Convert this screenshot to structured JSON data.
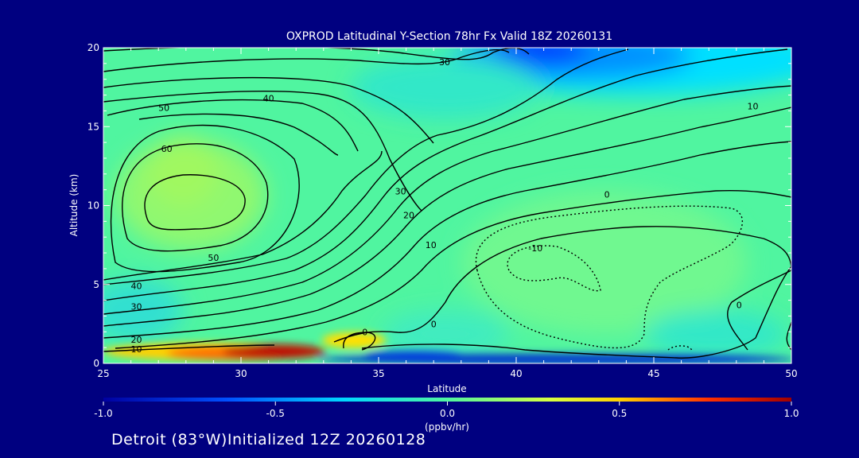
{
  "chart_data": {
    "type": "contour",
    "title": "OXPROD Latitudinal Y-Section 78hr  Fx Valid 18Z 20260131",
    "xlabel": "Latitude",
    "ylabel": "Altitude (km)",
    "xlim": [
      25,
      50
    ],
    "ylim": [
      0,
      20
    ],
    "x_ticks": [
      25,
      30,
      35,
      40,
      45,
      50
    ],
    "y_ticks": [
      0,
      5,
      10,
      15,
      20
    ],
    "colorbar": {
      "label": "(ppbv/hr)",
      "range": [
        -1.0,
        1.0
      ],
      "ticks": [
        "-1.0",
        "-0.5",
        "0.0",
        "0.5",
        "1.0"
      ],
      "tick_values": [
        -1.0,
        -0.5,
        0.0,
        0.5,
        1.0
      ]
    },
    "contour_labels": [
      {
        "text": "30",
        "x": 37.4,
        "y": 19.1
      },
      {
        "text": "40",
        "x": 31.0,
        "y": 16.8
      },
      {
        "text": "50",
        "x": 27.2,
        "y": 16.2
      },
      {
        "text": "60",
        "x": 27.3,
        "y": 13.6
      },
      {
        "text": "10",
        "x": 48.6,
        "y": 16.3
      },
      {
        "text": "30",
        "x": 35.8,
        "y": 10.9
      },
      {
        "text": "20",
        "x": 36.1,
        "y": 9.4
      },
      {
        "text": "10",
        "x": 36.9,
        "y": 7.5
      },
      {
        "text": "0",
        "x": 43.3,
        "y": 10.7
      },
      {
        "text": "-10",
        "x": 40.7,
        "y": 7.3
      },
      {
        "text": "50",
        "x": 29.0,
        "y": 6.7
      },
      {
        "text": "40",
        "x": 26.2,
        "y": 4.9
      },
      {
        "text": "30",
        "x": 26.2,
        "y": 3.6
      },
      {
        "text": "20",
        "x": 26.2,
        "y": 1.5
      },
      {
        "text": "10",
        "x": 26.2,
        "y": 0.9
      },
      {
        "text": "0",
        "x": 34.5,
        "y": 2.0
      },
      {
        "text": "0",
        "x": 37.0,
        "y": 2.5
      },
      {
        "text": "0",
        "x": 48.1,
        "y": 3.7
      }
    ]
  },
  "footer": "Detroit (83°W)Initialized 12Z 20260128",
  "colors": {
    "background": "#000080",
    "plot_base": "#50f5a0",
    "axes": "#ffffff",
    "contour": "#000000"
  }
}
